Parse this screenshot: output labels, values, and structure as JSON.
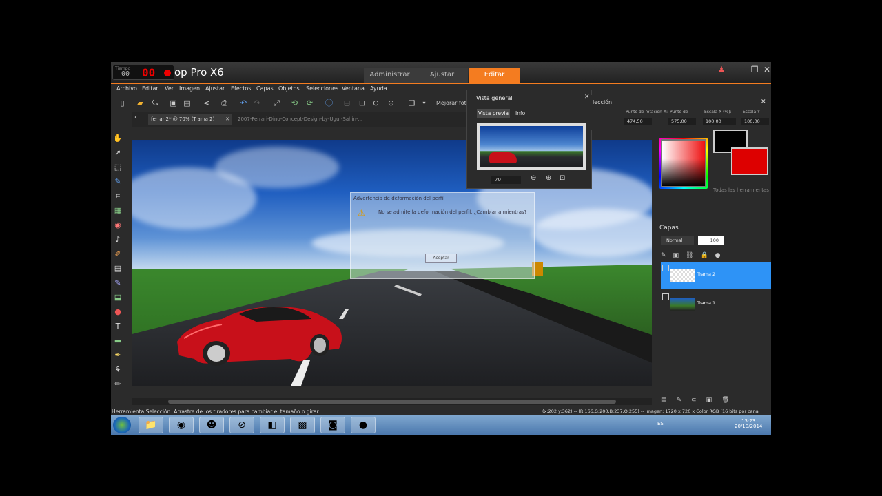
{
  "app": {
    "title": "op Pro X6",
    "recorder": {
      "label": "Tiempo",
      "counter": "00",
      "display": "00"
    }
  },
  "workspace_tabs": [
    "Administrar",
    "Ajustar",
    "Editar"
  ],
  "menu": [
    "Archivo",
    "Editar",
    "Ver",
    "Imagen",
    "Ajustar",
    "Efectos",
    "Capas",
    "Objetos",
    "Selecciones",
    "Ventana",
    "Ayuda"
  ],
  "toolbar": {
    "enhance_label": "Mejorar foto"
  },
  "documents": {
    "tab1": "ferrari2* @  70% (Trama 2)",
    "tab2": "2007-Ferrari-Dino-Concept-Design-by-Ugur-Sahin-..."
  },
  "overview": {
    "title": "Vista general",
    "tab_preview": "Vista previa",
    "tab_info": "Info",
    "zoom": "70"
  },
  "tool_options": {
    "title": "lección",
    "rot_x_label": "Punto de rotación X:",
    "rot_y_label": "Punto de",
    "scale_x_label": "Escala X (%):",
    "scale_y_label": "Escala Y",
    "rot_x": "474,50",
    "rot_y": "575,00",
    "scale_x": "100,00",
    "scale_y": "100,00"
  },
  "materials": {
    "all_tools": "Todas las herramientas",
    "fg_color": "#000000",
    "bg_color": "#d40000"
  },
  "dialog": {
    "title": "Advertencia de deformación del perfil",
    "text": "No se admite la deformación del perfil. ¿Cambiar a mientras?",
    "button": "Aceptar"
  },
  "layers": {
    "title": "Capas",
    "blend_mode": "Normal",
    "opacity": "100",
    "items": [
      {
        "name": "Trama 2",
        "selected": true
      },
      {
        "name": "Trama 1",
        "selected": false
      }
    ]
  },
  "status": {
    "left": "Herramienta Selección: Arrastre de los tiradores para cambiar el tamaño o girar.",
    "right": "(x:202 y:362) -- (R:166,G:200,B:237,O:255) -- Imagen:  1720 x 720 x Color RGB (16 bits por canal"
  },
  "taskbar": {
    "language": "ES",
    "time": "13:23",
    "date": "20/10/2014"
  }
}
